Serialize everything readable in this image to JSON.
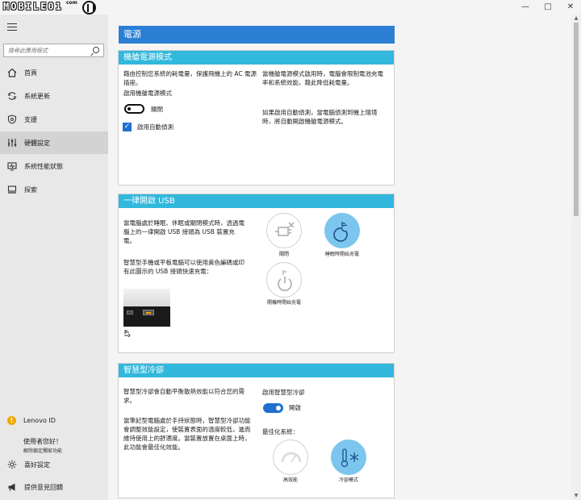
{
  "window": {
    "logo_text": "MOBILE01",
    "logo_suffix": "com",
    "minimize": "—",
    "maximize": "□",
    "close": "✕"
  },
  "sidebar": {
    "search_placeholder": "搜尋此應用程式",
    "items": [
      {
        "label": "首頁",
        "icon": "home-icon"
      },
      {
        "label": "系統更新",
        "icon": "update-icon"
      },
      {
        "label": "支援",
        "icon": "support-icon"
      },
      {
        "label": "硬體設定",
        "icon": "hardware-settings-icon",
        "active": true
      },
      {
        "label": "系統性能狀態",
        "icon": "system-health-icon"
      },
      {
        "label": "探索",
        "icon": "discover-icon"
      }
    ],
    "lenovo_id": "Lenovo ID",
    "guest_greeting": "使用者您好！",
    "guest_sub": "解除鎖定獨家功能",
    "preferences": "喜好設定",
    "feedback": "提供意見回饋"
  },
  "main": {
    "page_title": "電源",
    "airplane": {
      "header": "機艙電源模式",
      "desc": "藉由控制您系統的耗電量，保護飛機上的 AC 電源插座。",
      "enable_label": "啟用機艙電源模式",
      "toggle_state": "關閉",
      "auto_detect_label": "啟用自動偵測",
      "auto_detect_checked": true,
      "right_desc1": "當機艙電源模式啟用時，電腦會限制電池充電率和系統效能，藉此降低耗電量。",
      "right_desc2": "如果啟用自動偵測，當電腦偵測到機上環境時，將自動開啟機艙電源模式。"
    },
    "usb": {
      "header": "一律開啟 USB",
      "desc1": "當電腦處於睡眠、休眠或關閉模式時，透過電腦上的一律開啟 USB 接頭為 USB 裝置充電。",
      "desc2": "智慧型手機或平板電腦可以使用黃色編碼或印有此圖示的 USB 接頭快速充電：",
      "options": [
        {
          "label": "關閉",
          "selected": false
        },
        {
          "label": "睡眠時開始充電",
          "selected": true
        },
        {
          "label": "開機時開始充電",
          "selected": false
        }
      ]
    },
    "cooling": {
      "header": "智慧型冷卻",
      "desc1": "智慧型冷卻會自動平衡散熱效能以符合您的需求。",
      "desc2": "當筆記型電腦處於手持狀態時，智慧型冷卻功能會調整效能設定，使裝置表面的溫度較低，進而維持使用上的舒適度。當裝置放置在桌面上時，此功能會最佳化效能。",
      "enable_label": "啟用智慧型冷卻",
      "toggle_state": "開啟",
      "optimize_label": "最佳化系統：",
      "modes": [
        {
          "label": "高效能",
          "selected": false
        },
        {
          "label": "冷卻模式",
          "selected": true
        }
      ]
    }
  },
  "colors": {
    "accent": "#2a7fd4",
    "card_header": "#31b8dc",
    "selected_option": "#7cc6ee"
  }
}
